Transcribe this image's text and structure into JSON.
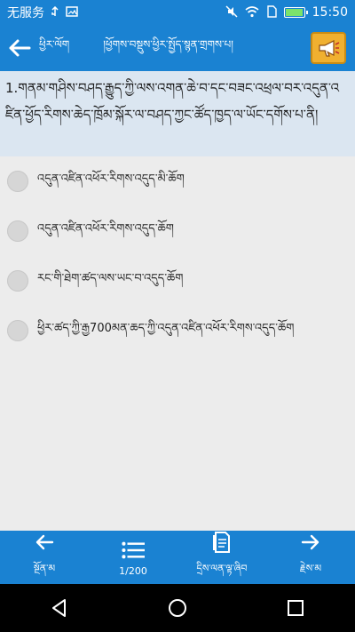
{
  "status": {
    "carrier": "无服务",
    "time": "15:50",
    "icons": [
      "usb-icon",
      "image-icon",
      "mute-icon",
      "wifi-icon",
      "sim-icon",
      "battery-icon"
    ]
  },
  "appbar": {
    "back_label": "ཕྱིར་ལོག",
    "title": "།ཕྱོགས་བསྡུས་ཕྱིར་སྤྱོད་སྙན་གྲགས་པ།"
  },
  "question": {
    "text": "1.གནམ་གཤིས་བཤད་རྒྱུད་ཀྱི་ལས་འགན་ཆེ་བ་དང་བཟང་འཕྲལ་བར་འདུན་འཛིན་ཕྱོད་རིགས་ཆེད་ཁྲོམ་སྐོར་ལ་བཤད་ཀྱང་ཚོད་ཁྱད་ལ་ཡོང་དགོས་པ་ནི།"
  },
  "options": [
    {
      "label": "འདུན་འཛིན་འཕོར་རིགས་འདུད་མི་ཆོག"
    },
    {
      "label": "འདུན་འཛིན་འཕོར་རིགས་འདུད་ཆོག"
    },
    {
      "label": "རང་གི་ཐེག་ཚད་ལས་ཡང་བ་འདུད་ཆོག"
    },
    {
      "label": "ཕྱིར་ཚད་ཀྱི་རྒྱ700མན་ཆད་ཀྱི་འདུན་འཛིན་འཕོར་རིགས་འདུད་ཆོག"
    }
  ],
  "bottombar": {
    "prev_label": "སྔོན་མ",
    "progress": "1/200",
    "answer_label": "དྲིས་ལན་ལྟ་ཞིབ",
    "next_label": "རྗེས་མ"
  },
  "colors": {
    "primary": "#1a82d2",
    "question_bg": "#dbe6f1",
    "page_bg": "#ececec",
    "accent": "#f0b030"
  }
}
